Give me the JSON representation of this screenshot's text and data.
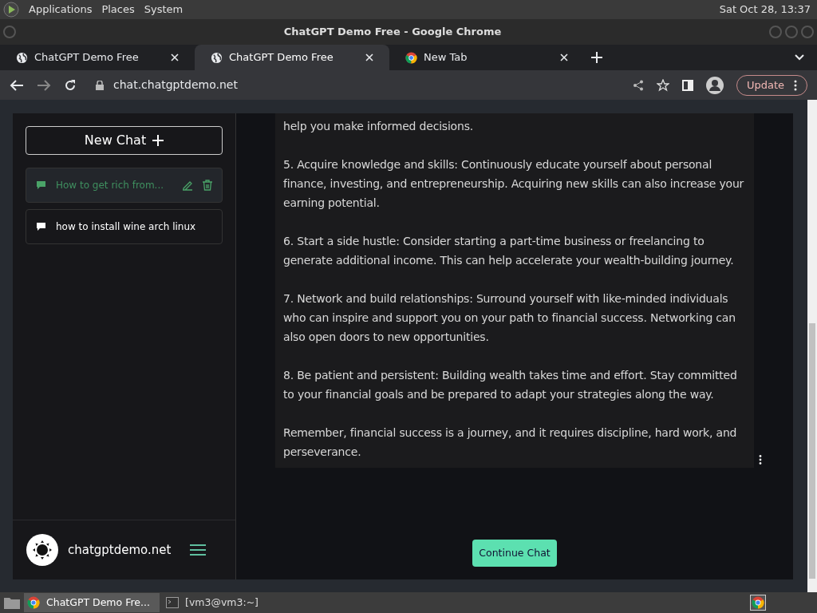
{
  "desktop_panel": {
    "menus": [
      "Applications",
      "Places",
      "System"
    ],
    "clock": "Sat Oct 28, 13:37"
  },
  "window": {
    "title": "ChatGPT Demo Free - Google Chrome"
  },
  "tabs": [
    {
      "label": "ChatGPT Demo Free",
      "selected": false,
      "kind": "globe"
    },
    {
      "label": "ChatGPT Demo Free",
      "selected": true,
      "kind": "globe"
    },
    {
      "label": "New Tab",
      "selected": false,
      "kind": "chrome"
    }
  ],
  "address_bar": {
    "url": "chat.chatgptdemo.net",
    "update_button": "Update"
  },
  "sidebar": {
    "new_chat_button": "New Chat",
    "chats": [
      {
        "title": "How to get rich from...",
        "selected": true
      },
      {
        "title": "how to install wine arch linux",
        "selected": false
      }
    ],
    "brand": "chatgptdemo.net"
  },
  "message": {
    "paragraphs": [
      "help you make informed decisions.",
      "5. Acquire knowledge and skills: Continuously educate yourself about personal finance, investing, and entrepreneurship. Acquiring new skills can also increase your earning potential.",
      "6. Start a side hustle: Consider starting a part-time business or freelancing to generate additional income. This can help accelerate your wealth-building journey.",
      "7. Network and build relationships: Surround yourself with like-minded individuals who can inspire and support you on your path to financial success. Networking can also open doors to new opportunities.",
      "8. Be patient and persistent: Building wealth takes time and effort. Stay committed to your financial goals and be prepared to adapt your strategies along the way.",
      "Remember, financial success is a journey, and it requires discipline, hard work, and perseverance."
    ]
  },
  "continue_button": "Continue Chat",
  "taskbar": {
    "items": [
      {
        "label": "ChatGPT Demo Fre...",
        "selected": true,
        "kind": "chrome"
      },
      {
        "label": "[vm3@vm3:~]",
        "selected": false,
        "kind": "terminal"
      }
    ]
  }
}
